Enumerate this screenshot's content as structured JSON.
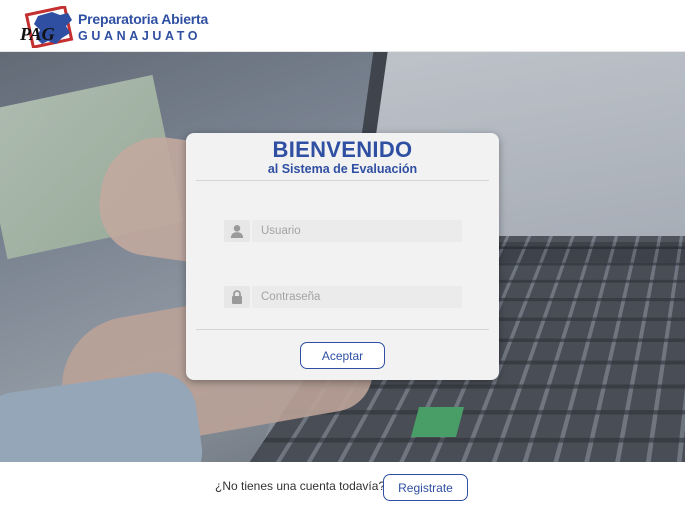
{
  "header": {
    "brand_line1": "Preparatoria Abierta",
    "brand_line2": "GUANAJUATO",
    "logo_letters": "PAG",
    "brand_color": "#2f4fa2"
  },
  "login": {
    "title": "BIENVENIDO",
    "subtitle": "al Sistema de Evaluación",
    "username_placeholder": "Usuario",
    "username_icon": "user-icon",
    "password_placeholder": "Contraseña",
    "password_icon": "lock-icon",
    "submit_label": "Aceptar"
  },
  "footer": {
    "prompt": "¿No tienes una cuenta todavía?",
    "register_label": "Registrate"
  },
  "colors": {
    "accent": "#2f4fa2",
    "card_bg": "#f2f2f2",
    "input_bg": "#ebebeb"
  }
}
